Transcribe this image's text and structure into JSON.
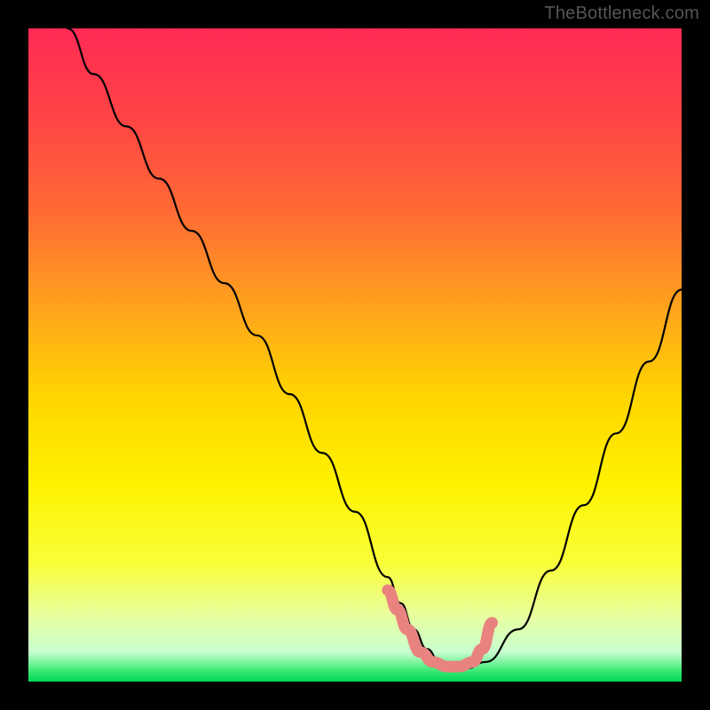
{
  "attribution": "TheBottleneck.com",
  "chart_data": {
    "type": "line",
    "title": "",
    "xlabel": "",
    "ylabel": "",
    "xlim": [
      0,
      100
    ],
    "ylim": [
      0,
      100
    ],
    "gradient_stops": [
      {
        "offset": 0.0,
        "color": "#ff2a55"
      },
      {
        "offset": 0.14,
        "color": "#ff4545"
      },
      {
        "offset": 0.28,
        "color": "#ff6a34"
      },
      {
        "offset": 0.42,
        "color": "#ffa01e"
      },
      {
        "offset": 0.56,
        "color": "#ffd400"
      },
      {
        "offset": 0.7,
        "color": "#fff200"
      },
      {
        "offset": 0.82,
        "color": "#f8ff3a"
      },
      {
        "offset": 0.9,
        "color": "#e8ffa0"
      },
      {
        "offset": 0.955,
        "color": "#c8ffd0"
      },
      {
        "offset": 0.985,
        "color": "#34e870"
      },
      {
        "offset": 1.0,
        "color": "#00d85a"
      }
    ],
    "series": [
      {
        "name": "bottleneck-curve",
        "color": "#000000",
        "x": [
          6,
          10,
          15,
          20,
          25,
          30,
          35,
          40,
          45,
          50,
          55,
          57,
          59,
          61,
          63,
          65,
          67,
          70,
          75,
          80,
          85,
          90,
          95,
          100
        ],
        "values": [
          100,
          93,
          85,
          77,
          69,
          61,
          53,
          44,
          35,
          26,
          16,
          12,
          8,
          5,
          3,
          2,
          2,
          3,
          8,
          17,
          27,
          38,
          49,
          60
        ]
      },
      {
        "name": "optimal-range-marker",
        "color": "#e8837f",
        "x": [
          55,
          56.5,
          58,
          60,
          62,
          64,
          66,
          68,
          69.5,
          71
        ],
        "values": [
          14,
          11,
          8,
          4.5,
          3,
          2.3,
          2.3,
          3,
          5,
          9
        ]
      }
    ],
    "optimal_range": {
      "x_start": 55,
      "x_end": 71
    }
  }
}
